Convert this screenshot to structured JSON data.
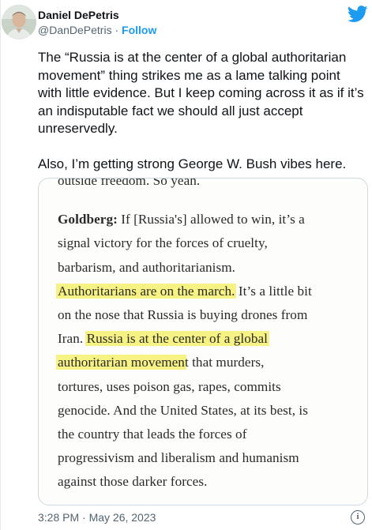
{
  "author": {
    "name": "Daniel DePetris",
    "handle": "@DanDePetris",
    "separator": "·",
    "follow_label": "Follow"
  },
  "tweet": {
    "paragraphs": [
      "The “Russia is at the center of a global authoritarian movement” thing strikes me as a lame talking point with little evidence. But I keep coming across it as if it’s an indisputable fact we should all just accept unreservedly.",
      "Also, I’m getting strong George W. Bush vibes here."
    ]
  },
  "media": {
    "cut_line": "outside freedom. So yeah.",
    "speaker": "Goldberg:",
    "lines": {
      "l1_rest": " If [Russia's] allowed to win, it’s a",
      "l2": "signal victory for the forces of cruelty,",
      "l3": "barbarism, and authoritarianism.",
      "l4_highlight": "Authoritarians are on the march.",
      "l4_rest": " It’s a little bit",
      "l5": "on the nose that Russia is buying drones from",
      "l6_pre": "Iran. ",
      "l6_highlight": "Russia is at the center of a global",
      "l7_highlight": "authoritarian movemen",
      "l7_rest": "t that murders,",
      "l8": "tortures, uses poison gas, rapes, commits",
      "l9": "genocide. And the United States, at its best, is",
      "l10": "the country that leads the forces of",
      "l11": "progressivism and liberalism and humanism",
      "l12": "against those darker forces."
    }
  },
  "meta": {
    "timestamp": "3:28 PM · May 26, 2023",
    "info_glyph": "i"
  },
  "colors": {
    "brand_blue": "#1d9bf0",
    "highlight": "#f6f06e",
    "muted": "#536471"
  },
  "icons": [
    "twitter-bird-icon",
    "info-icon"
  ]
}
